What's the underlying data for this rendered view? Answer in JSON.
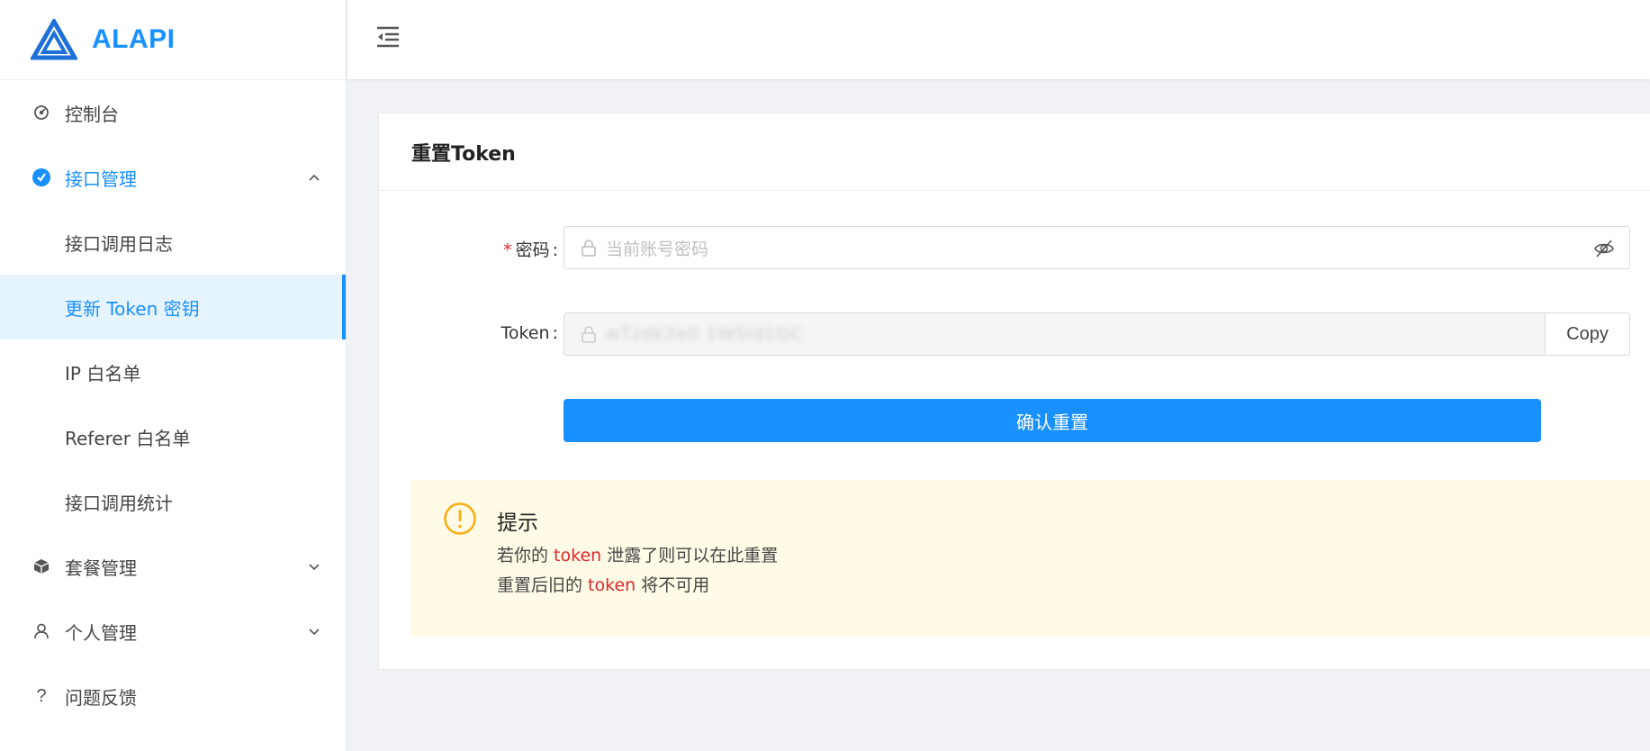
{
  "brand": {
    "name": "ALAPI",
    "color": "#1890ff"
  },
  "sidebar": {
    "items": [
      {
        "label": "控制台",
        "icon": "dashboard-icon"
      },
      {
        "label": "接口管理",
        "icon": "check-circle-icon",
        "expanded": true
      },
      {
        "label": "接口调用日志"
      },
      {
        "label": "更新 Token 密钥",
        "selected": true
      },
      {
        "label": "IP 白名单"
      },
      {
        "label": "Referer 白名单"
      },
      {
        "label": "接口调用统计"
      },
      {
        "label": "套餐管理",
        "icon": "package-icon"
      },
      {
        "label": "个人管理",
        "icon": "user-icon"
      },
      {
        "label": "问题反馈",
        "icon": "question-icon"
      }
    ]
  },
  "card": {
    "title": "重置Token",
    "password_label": "密码",
    "password_required_mark": "*",
    "password_placeholder": "当前账号密码",
    "token_label": "Token",
    "label_colon": ":",
    "token_value": "wTzdk2e0 1W5ld1DC",
    "copy_label": "Copy",
    "confirm_label": "确认重置"
  },
  "alert": {
    "title": "提示",
    "line1": {
      "before": "若你的 ",
      "highlight": "token",
      "after": " 泄露了则可以在此重置"
    },
    "line2": {
      "before": "重置后旧的 ",
      "highlight": "token",
      "after": " 将不可用"
    }
  },
  "colors": {
    "primary": "#1890ff",
    "danger": "#e0282b",
    "warning": "#faad14",
    "alert_bg": "#fffbe6"
  }
}
